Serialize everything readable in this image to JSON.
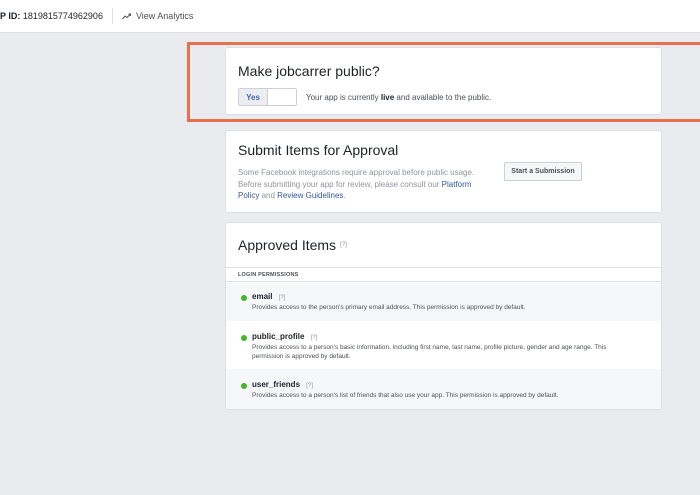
{
  "topbar": {
    "app_id_label": "P ID:",
    "app_id_value": "1819815774962906",
    "view_analytics": "View Analytics"
  },
  "make_public": {
    "title": "Make jobcarrer public?",
    "toggle_label": "Yes",
    "status_prefix": "Your app is currently ",
    "status_bold": "live",
    "status_suffix": " and available to the public."
  },
  "submit": {
    "title": "Submit Items for Approval",
    "desc_line1": "Some Facebook integrations require approval before public usage.",
    "desc_line2": "Before submitting your app for review, please consult our ",
    "platform_policy_link": "Platform Policy",
    "and_text": " and ",
    "review_guidelines_link": "Review Guidelines",
    "period": ".",
    "button_label": "Start a Submission"
  },
  "approved": {
    "title": "Approved Items",
    "help": "[?]",
    "section_label": "LOGIN PERMISSIONS",
    "permissions": [
      {
        "name": "email",
        "help": "[?]",
        "description": "Provides access to the person's primary email address. This permission is approved by default."
      },
      {
        "name": "public_profile",
        "help": "[?]",
        "description": "Provides access to a person's basic information, including first name, last name, profile picture, gender and age range. This permission is approved by default."
      },
      {
        "name": "user_friends",
        "help": "[?]",
        "description": "Provides access to a person's list of friends that also use your app. This permission is approved by default."
      }
    ]
  },
  "colors": {
    "page_background": "#e9ebee",
    "highlight_border": "#e8704f",
    "status_dot": "#42b72a",
    "link": "#365899"
  },
  "icons": {
    "analytics": "trend-line-icon"
  }
}
